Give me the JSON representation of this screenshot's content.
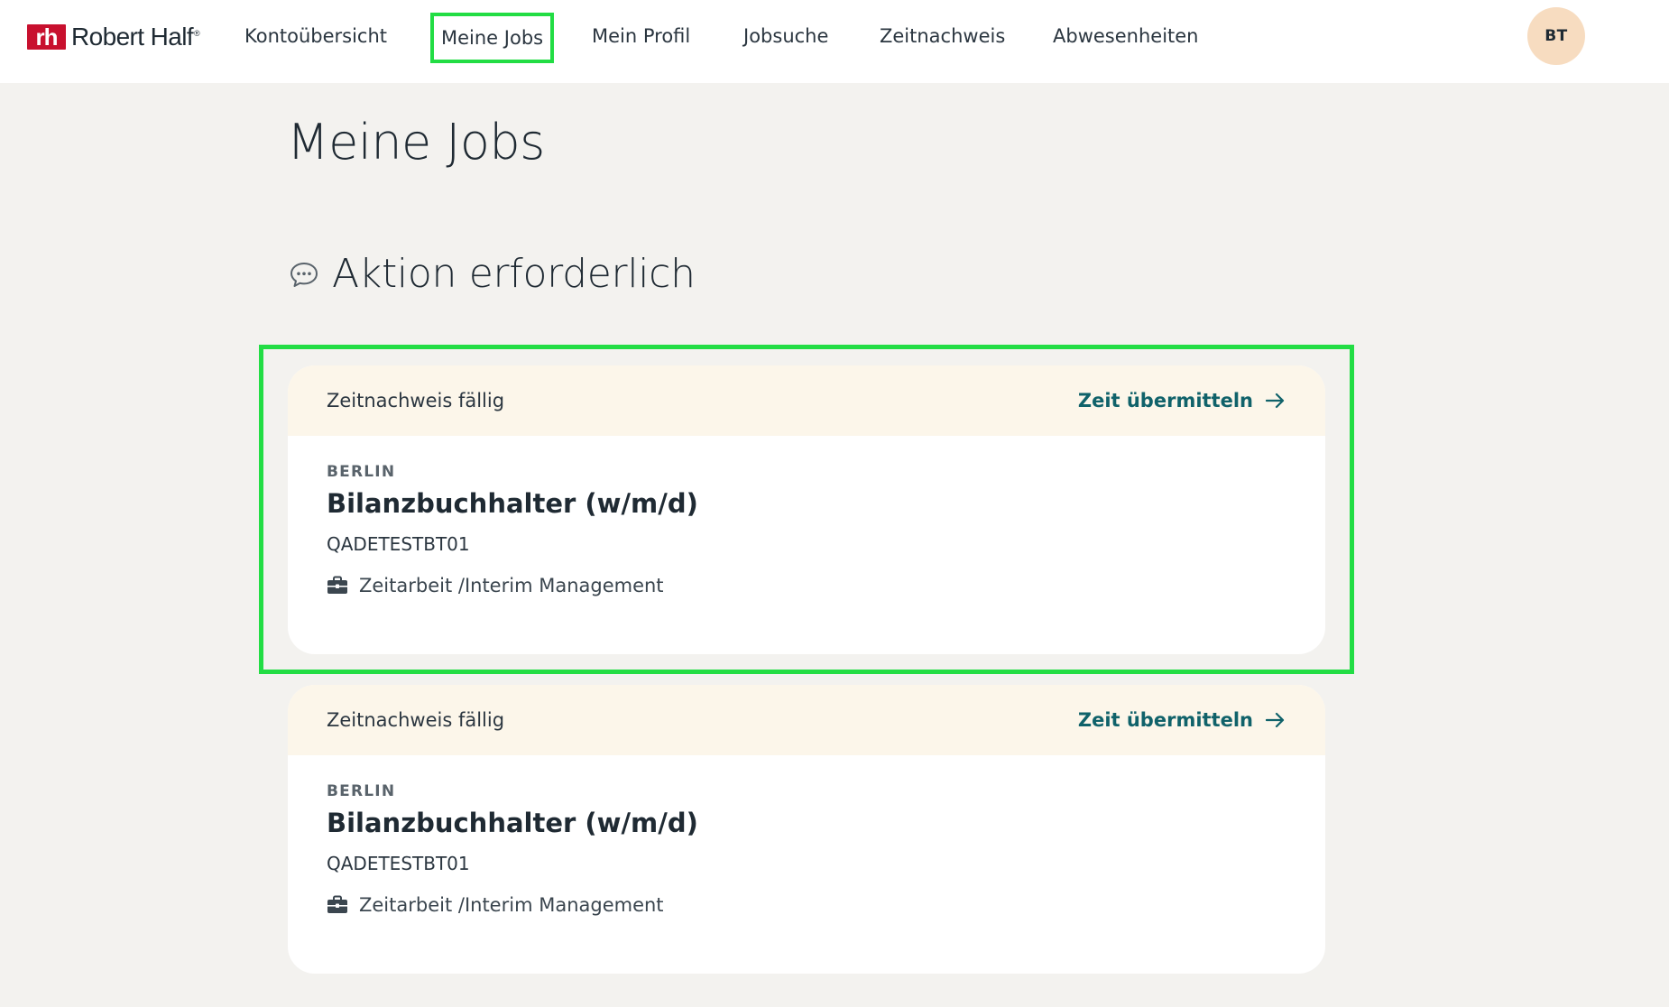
{
  "header": {
    "logo_mark": "rh",
    "logo_text": "Robert Half",
    "logo_reg": "®",
    "nav": [
      {
        "label": "Kontoübersicht",
        "active": false
      },
      {
        "label": "Meine Jobs",
        "active": true
      },
      {
        "label": "Mein Profil",
        "active": false
      },
      {
        "label": "Jobsuche",
        "active": false
      },
      {
        "label": "Zeitnachweis",
        "active": false
      },
      {
        "label": "Abwesenheiten",
        "active": false
      }
    ],
    "avatar_initials": "BT"
  },
  "main": {
    "page_title": "Meine Jobs",
    "section_title": "Aktion erforderlich",
    "section_icon": "chat-bubble-icon",
    "cards": [
      {
        "banner_label": "Zeitnachweis fällig",
        "banner_action": "Zeit übermitteln",
        "location": "BERLIN",
        "title": "Bilanzbuchhalter (w/m/d)",
        "job_id": "QADETESTBT01",
        "job_type_icon": "briefcase-icon",
        "job_type": "Zeitarbeit /Interim Management"
      },
      {
        "banner_label": "Zeitnachweis fällig",
        "banner_action": "Zeit übermitteln",
        "location": "BERLIN",
        "title": "Bilanzbuchhalter (w/m/d)",
        "job_id": "QADETESTBT01",
        "job_type_icon": "briefcase-icon",
        "job_type": "Zeitarbeit /Interim Management"
      }
    ]
  },
  "colors": {
    "brand": "#c8102e",
    "link": "#10626a",
    "highlight": "#22dd44",
    "banner_bg": "#fcf6ea",
    "avatar_bg": "#f7dcc0",
    "page_bg": "#f3f2ef"
  }
}
